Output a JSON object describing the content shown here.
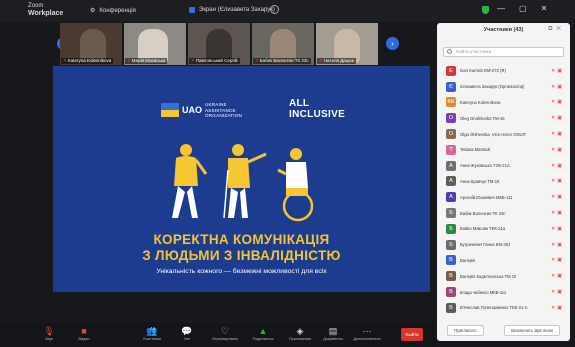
{
  "window": {
    "app_line1": "Zoom",
    "app_line2": "Workplace",
    "conference_label": "Конференція",
    "share_label": "Экран (Єлизавета Захарук)"
  },
  "titlebar_buttons": [
    "—",
    "▢",
    "✕"
  ],
  "filmstrip": [
    {
      "name": "Kateryna Kolesnikova"
    },
    {
      "name": "Марія Маєвська"
    },
    {
      "name": "Павловський Сергій"
    },
    {
      "name": "Бабяк Валентин ТК 23с"
    },
    {
      "name": "Наталя Дацюк"
    }
  ],
  "slide": {
    "org_short": "UAO",
    "org_line1": "UKRAINE",
    "org_line2": "ASSISTANCE",
    "org_line3": "ORGANIZATION",
    "project_line1": "ALL",
    "project_line2": "INCLUSIVE",
    "title_line1": "КОРЕКТНА КОМУНІКАЦІЯ",
    "title_line2": "З ЛЮДЬМИ З ІНВАЛІДНІСТЮ",
    "subtitle": "Унікальність кожного — безмежні можливості для всіх",
    "colors": {
      "background": "#1d3c8f",
      "title": "#f5c631",
      "figure": "#f5c631"
    }
  },
  "participants": {
    "title": "Участники (43)",
    "search_placeholder": "Найти участника",
    "items": [
      {
        "initial": "E",
        "color": "#d23a3a",
        "name": "Ivan Kumsin EM-272 (Я)"
      },
      {
        "initial": "Є",
        "color": "#3a5fd2",
        "name": "Єлизавета Захарук (Організатор)"
      },
      {
        "initial": "KK",
        "color": "#e08a2d",
        "name": "Kateryna Kolesnikova"
      },
      {
        "initial": "O",
        "color": "#7b3fb5",
        "name": "Oleg Onufriienko TM-15"
      },
      {
        "initial": "O",
        "color": "#8a6a55",
        "name": "Olga Olshevska, Vice-rector ONUIT"
      },
      {
        "initial": "T",
        "color": "#d46a9b",
        "name": "Tetiana Martsiuk"
      },
      {
        "initial": "А",
        "color": "#6f6f6f",
        "name": "Анна Жуковська ТЭК-21А"
      },
      {
        "initial": "А",
        "color": "#5d5d5d",
        "name": "Анна Кравчук TM-15"
      },
      {
        "initial": "А",
        "color": "#4a3fb5",
        "name": "Арсеній Юшкевич МКБ-111"
      },
      {
        "initial": "Б",
        "color": "#777777",
        "name": "Бабяк Валентин ТК 23с"
      },
      {
        "initial": "Б",
        "color": "#2b8a3e",
        "name": "Бойко Максим ТЕК-21а"
      },
      {
        "initial": "Б",
        "color": "#6b6b6b",
        "name": "Буграчевич Ганна ЕМ-361"
      },
      {
        "initial": "В",
        "color": "#3a5fd2",
        "name": "Валерія"
      },
      {
        "initial": "В",
        "color": "#7a5a4a",
        "name": "Валерія Кадетлинська ТМ 15"
      },
      {
        "initial": "В",
        "color": "#9a4a7a",
        "name": "влада чабенко МКБ-111"
      },
      {
        "initial": "В",
        "color": "#5a5a5a",
        "name": "В'ячеслав Почепцовенко ТЕК-21-А"
      }
    ],
    "invite_label": "Пригласить",
    "mute_all_label": "Выключить звук всем"
  },
  "toolbar": {
    "items": [
      {
        "icon": "mic-off-icon",
        "glyph": "🎙",
        "label": "Звук",
        "tone": "red"
      },
      {
        "icon": "video-off-icon",
        "glyph": "■",
        "label": "Видео",
        "tone": "red"
      },
      {
        "icon": "participants-icon",
        "glyph": "👥",
        "label": "Участники",
        "tone": "normal"
      },
      {
        "icon": "chat-icon",
        "glyph": "💬",
        "label": "Чат",
        "tone": "normal"
      },
      {
        "icon": "react-icon",
        "glyph": "♡",
        "label": "Отреагировать",
        "tone": "normal"
      },
      {
        "icon": "share-icon",
        "glyph": "▲",
        "label": "Поделиться",
        "tone": "green"
      },
      {
        "icon": "apps-icon",
        "glyph": "◈",
        "label": "Приложения",
        "tone": "normal"
      },
      {
        "icon": "docs-icon",
        "glyph": "▤",
        "label": "Документы",
        "tone": "normal"
      },
      {
        "icon": "more-icon",
        "glyph": "⋯",
        "label": "Дополнительно",
        "tone": "normal"
      }
    ],
    "participant_count": "44",
    "leave_label": "Выйти"
  }
}
